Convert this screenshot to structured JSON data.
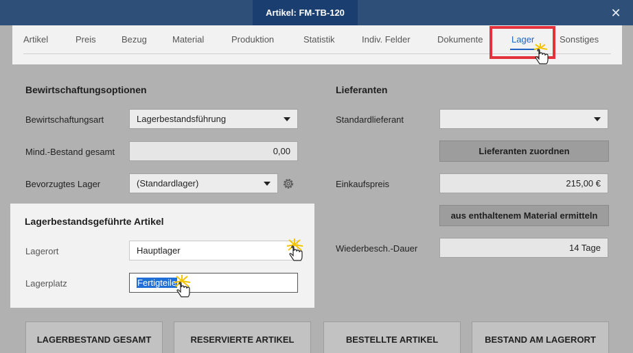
{
  "window": {
    "title": "Artikel: FM-TB-120",
    "close_icon": "close-icon"
  },
  "tabs": [
    {
      "label": "Artikel"
    },
    {
      "label": "Preis"
    },
    {
      "label": "Bezug"
    },
    {
      "label": "Material"
    },
    {
      "label": "Produktion"
    },
    {
      "label": "Statistik"
    },
    {
      "label": "Indiv. Felder"
    },
    {
      "label": "Dokumente"
    },
    {
      "label": "Lager",
      "active": true
    },
    {
      "label": "Sonstiges"
    }
  ],
  "bewirtschaftung": {
    "title": "Bewirtschaftungsoptionen",
    "art_label": "Bewirtschaftungsart",
    "art_value": "Lagerbestandsführung",
    "mind_label": "Mind.-Bestand gesamt",
    "mind_value": "0,00",
    "lager_label": "Bevorzugtes Lager",
    "lager_value": "(Standardlager)"
  },
  "lieferanten": {
    "title": "Lieferanten",
    "standard_label": "Standardlieferant",
    "standard_value": "",
    "zuordnen_label": "Lieferanten zuordnen",
    "einkauf_label": "Einkaufspreis",
    "einkauf_value": "215,00 €",
    "material_btn_label": "aus enthaltenem Material ermitteln",
    "dauer_label": "Wiederbesch.-Dauer",
    "dauer_value": "14 Tage"
  },
  "lagerbestand": {
    "title": "Lagerbestandsgeführte Artikel",
    "ort_label": "Lagerort",
    "ort_value": "Hauptlager",
    "platz_label": "Lagerplatz",
    "platz_value": "Fertigteile"
  },
  "bottom_buttons": [
    {
      "label": "LAGERBESTAND GESAMT"
    },
    {
      "label": "RESERVIERTE ARTIKEL"
    },
    {
      "label": "BESTELLTE ARTIKEL"
    },
    {
      "label": "BESTAND AM LAGERORT"
    }
  ],
  "colors": {
    "accent": "#1b64c6",
    "highlight": "#e4323c",
    "titlebar": "#2e4f78",
    "title_tab": "#1a3e6f"
  }
}
